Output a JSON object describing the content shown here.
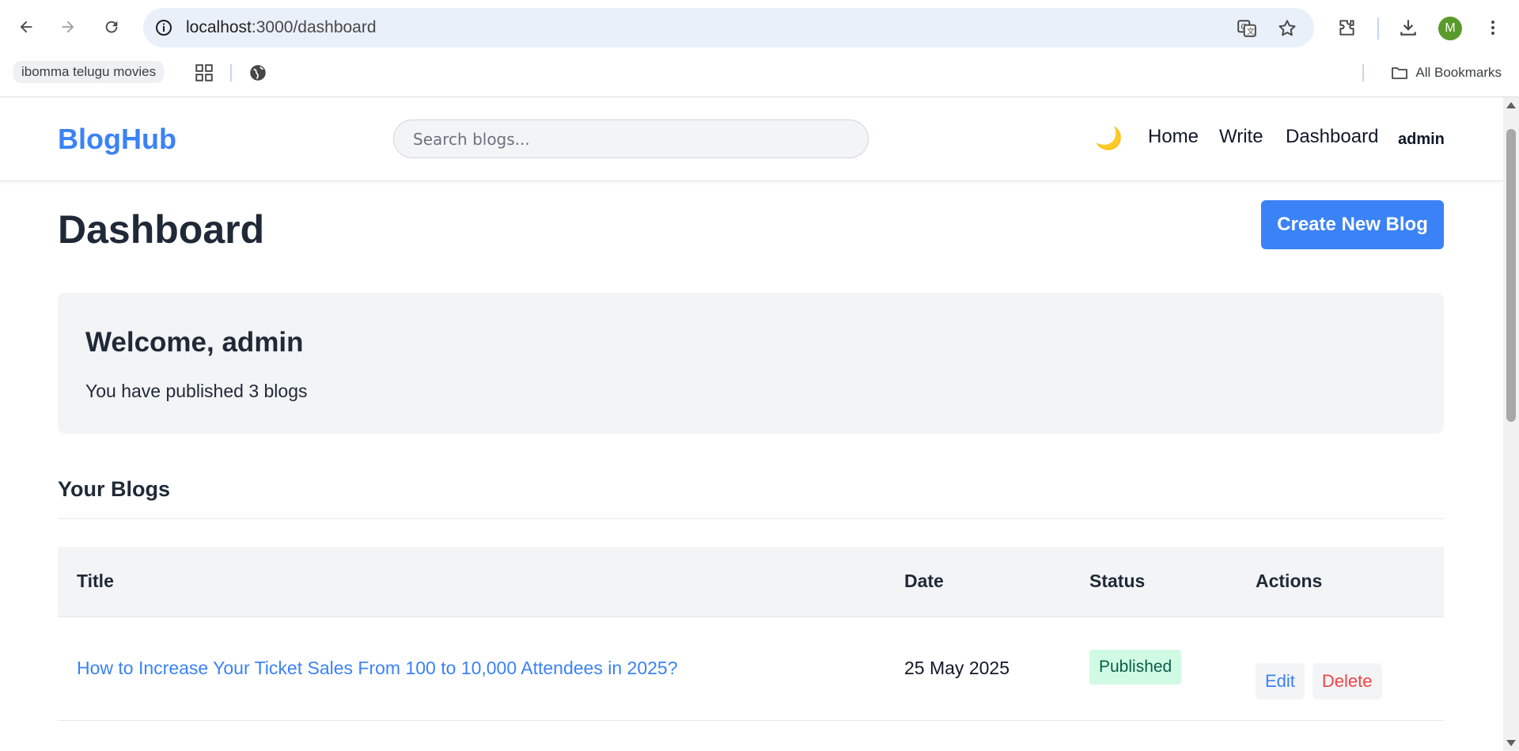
{
  "browser": {
    "url_host": "localhost",
    "url_path": ":3000/dashboard",
    "bookmark_chip": "ibomma telugu movies",
    "all_bookmarks": "All Bookmarks",
    "profile_initial": "M"
  },
  "app": {
    "logo": "BlogHub",
    "search_placeholder": "Search blogs...",
    "theme_toggle": "🌙",
    "nav": {
      "home": "Home",
      "write": "Write",
      "dashboard": "Dashboard",
      "user": "admin"
    }
  },
  "dashboard": {
    "title": "Dashboard",
    "create_button": "Create New Blog",
    "welcome_heading": "Welcome, admin",
    "welcome_text": "You have published 3 blogs",
    "section_title": "Your Blogs",
    "table": {
      "headers": [
        "Title",
        "Date",
        "Status",
        "Actions"
      ],
      "rows": [
        {
          "title": "How to Increase Your Ticket Sales From 100 to 10,000 Attendees in 2025?",
          "date": "25 May 2025",
          "status": "Published",
          "edit": "Edit",
          "delete": "Delete"
        }
      ]
    }
  }
}
